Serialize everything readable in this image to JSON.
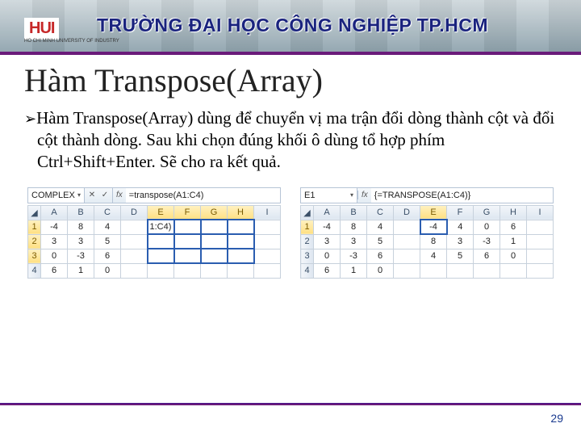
{
  "header": {
    "logo_text": "HUI",
    "logo_sub": "HO CHI MINH UNIVERSITY OF INDUSTRY",
    "university": "TRƯỜNG ĐẠI HỌC CÔNG NGHIỆP TP.HCM"
  },
  "title": "Hàm Transpose(Array)",
  "body": "Hàm Transpose(Array) dùng để chuyển vị ma trận đổi dòng thành cột và đổi cột thành dòng. Sau khi chọn đúng khối ô dùng tổ hợp phím Ctrl+Shift+Enter. Sẽ cho ra kết quả.",
  "sheets": {
    "left": {
      "name_box": "COMPLEX",
      "formula": "=transpose(A1:C4)",
      "columns": [
        "A",
        "B",
        "C",
        "D",
        "E",
        "F",
        "G",
        "H",
        "I"
      ],
      "rows": [
        [
          "-4",
          "8",
          "4",
          "",
          "1:C4)",
          "",
          "",
          "",
          ""
        ],
        [
          "3",
          "3",
          "5",
          "",
          "",
          "",
          "",
          "",
          ""
        ],
        [
          "0",
          "-3",
          "6",
          "",
          "",
          "",
          "",
          "",
          ""
        ],
        [
          "6",
          "1",
          "0",
          "",
          "",
          "",
          "",
          "",
          ""
        ]
      ],
      "sel_from": {
        "r": 0,
        "c": 4
      },
      "sel_to": {
        "r": 2,
        "c": 7
      }
    },
    "right": {
      "name_box": "E1",
      "formula": "{=TRANSPOSE(A1:C4)}",
      "columns": [
        "A",
        "B",
        "C",
        "D",
        "E",
        "F",
        "G",
        "H",
        "I"
      ],
      "rows": [
        [
          "-4",
          "8",
          "4",
          "",
          "-4",
          "4",
          "0",
          "6",
          ""
        ],
        [
          "3",
          "3",
          "5",
          "",
          "8",
          "3",
          "-3",
          "1",
          ""
        ],
        [
          "0",
          "-3",
          "6",
          "",
          "4",
          "5",
          "6",
          "0",
          ""
        ],
        [
          "6",
          "1",
          "0",
          "",
          "",
          "",
          "",
          "",
          ""
        ]
      ],
      "active_cell": {
        "r": 0,
        "c": 4
      }
    }
  },
  "page_number": "29"
}
